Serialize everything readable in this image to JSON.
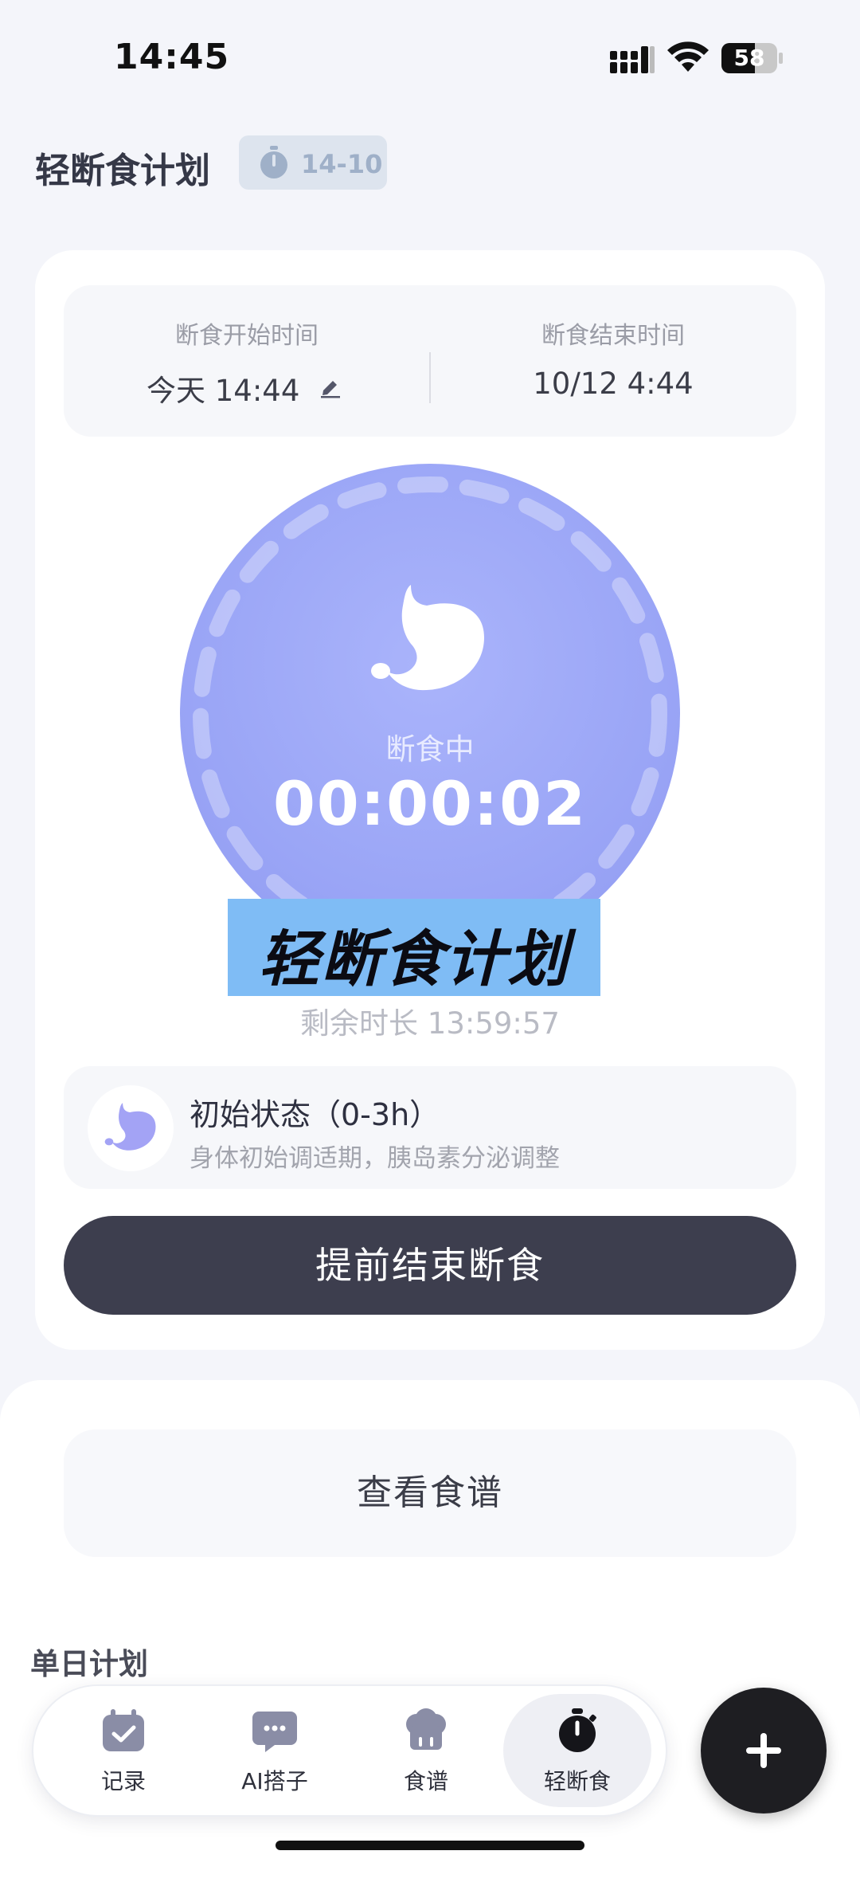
{
  "status_bar": {
    "time": "14:45",
    "battery": "58"
  },
  "header": {
    "title": "轻断食计划",
    "plan_badge": "14-10"
  },
  "fasting": {
    "start_label": "断食开始时间",
    "start_value": "今天 14:44",
    "end_label": "断食结束时间",
    "end_value": "10/12  4:44",
    "status": "断食中",
    "timer": "00:00:02",
    "remaining": "剩余时长 13:59:57"
  },
  "promo": {
    "text": "轻断食计划"
  },
  "stage": {
    "title": "初始状态（0-3h）",
    "description": "身体初始调适期，胰岛素分泌调整"
  },
  "actions": {
    "end_early": "提前结束断食",
    "view_recipes": "查看食谱"
  },
  "section": {
    "daily_plan": "单日计划"
  },
  "tabs": [
    {
      "label": "记录",
      "icon": "calendar-check-icon"
    },
    {
      "label": "AI搭子",
      "icon": "chat-bubble-icon"
    },
    {
      "label": "食谱",
      "icon": "chef-hat-icon"
    },
    {
      "label": "轻断食",
      "icon": "stopwatch-icon",
      "active": true
    }
  ],
  "colors": {
    "accent": "#9aa5f6",
    "button_dark": "#3d3e4e",
    "promo_bg": "#7fbcf5"
  }
}
